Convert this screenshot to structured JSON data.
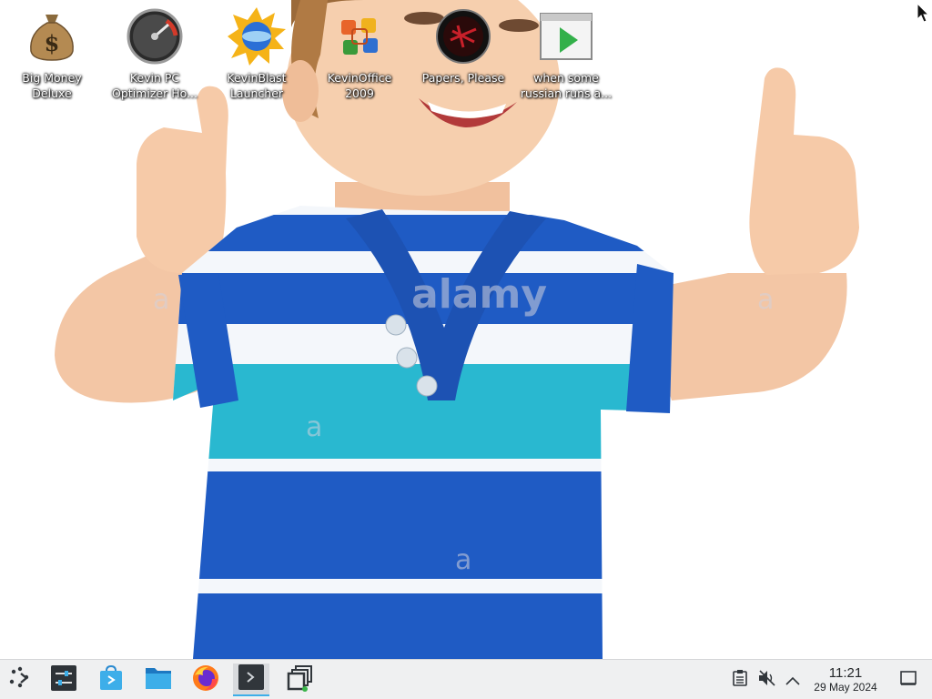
{
  "desktop": {
    "icons": [
      {
        "label": "Big Money\nDeluxe",
        "icon": "money-bag-icon"
      },
      {
        "label": "Kevin PC\nOptimizer Ho...",
        "icon": "speedometer-icon"
      },
      {
        "label": "KevinBlast\nLauncher",
        "icon": "sun-disc-icon"
      },
      {
        "label": "KevinOffice\n2009",
        "icon": "office-logo-icon"
      },
      {
        "label": "Papers, Please",
        "icon": "papers-please-icon"
      },
      {
        "label": "when some\nrussian runs a...",
        "icon": "video-play-icon"
      }
    ]
  },
  "wallpaper": {
    "watermarks": [
      "alamy",
      "a",
      "a",
      "a",
      "a"
    ]
  },
  "taskbar": {
    "launchers": [
      {
        "icon": "application-launcher-icon"
      },
      {
        "icon": "system-settings-icon"
      },
      {
        "icon": "discover-store-icon"
      },
      {
        "icon": "file-manager-icon"
      },
      {
        "icon": "firefox-icon"
      },
      {
        "icon": "terminal-icon"
      },
      {
        "icon": "window-switcher-icon"
      }
    ],
    "tray": [
      {
        "icon": "clipboard-icon"
      },
      {
        "icon": "volume-muted-icon"
      },
      {
        "icon": "chevron-up-icon"
      }
    ],
    "clock": {
      "time": "11:21",
      "date": "29 May 2024"
    },
    "show_desktop": {
      "icon": "show-desktop-icon"
    }
  },
  "colors": {
    "taskbar_bg": "#eff0f1",
    "accent": "#3daee9",
    "shirt_blue": "#1f5bc4",
    "shirt_teal": "#29b8d0"
  }
}
